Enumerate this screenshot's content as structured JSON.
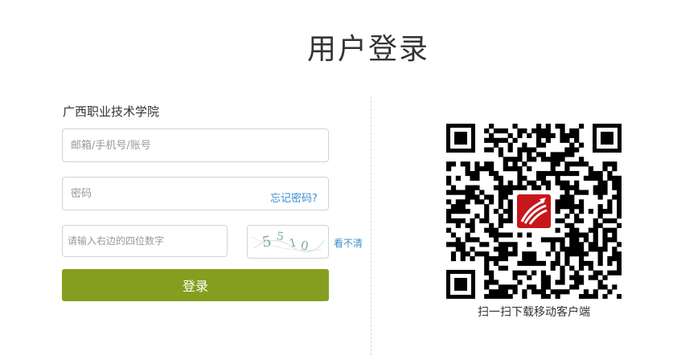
{
  "page": {
    "title": "用户登录"
  },
  "login": {
    "school": "广西职业技术学院",
    "account_placeholder": "邮箱/手机号/账号",
    "password_placeholder": "密码",
    "forgot_password": "忘记密码?",
    "captcha_placeholder": "请输入右边的四位数字",
    "captcha_text": "5510",
    "refresh_captcha": "看不清",
    "login_button": "登录"
  },
  "download": {
    "caption": "扫一扫下载移动客户端",
    "qr_icon": "qr-code",
    "logo_icon": "xuexitong-logo",
    "logo_color": "#c8161d"
  },
  "colors": {
    "login_button": "#869e1f",
    "link": "#3a8fd0"
  }
}
